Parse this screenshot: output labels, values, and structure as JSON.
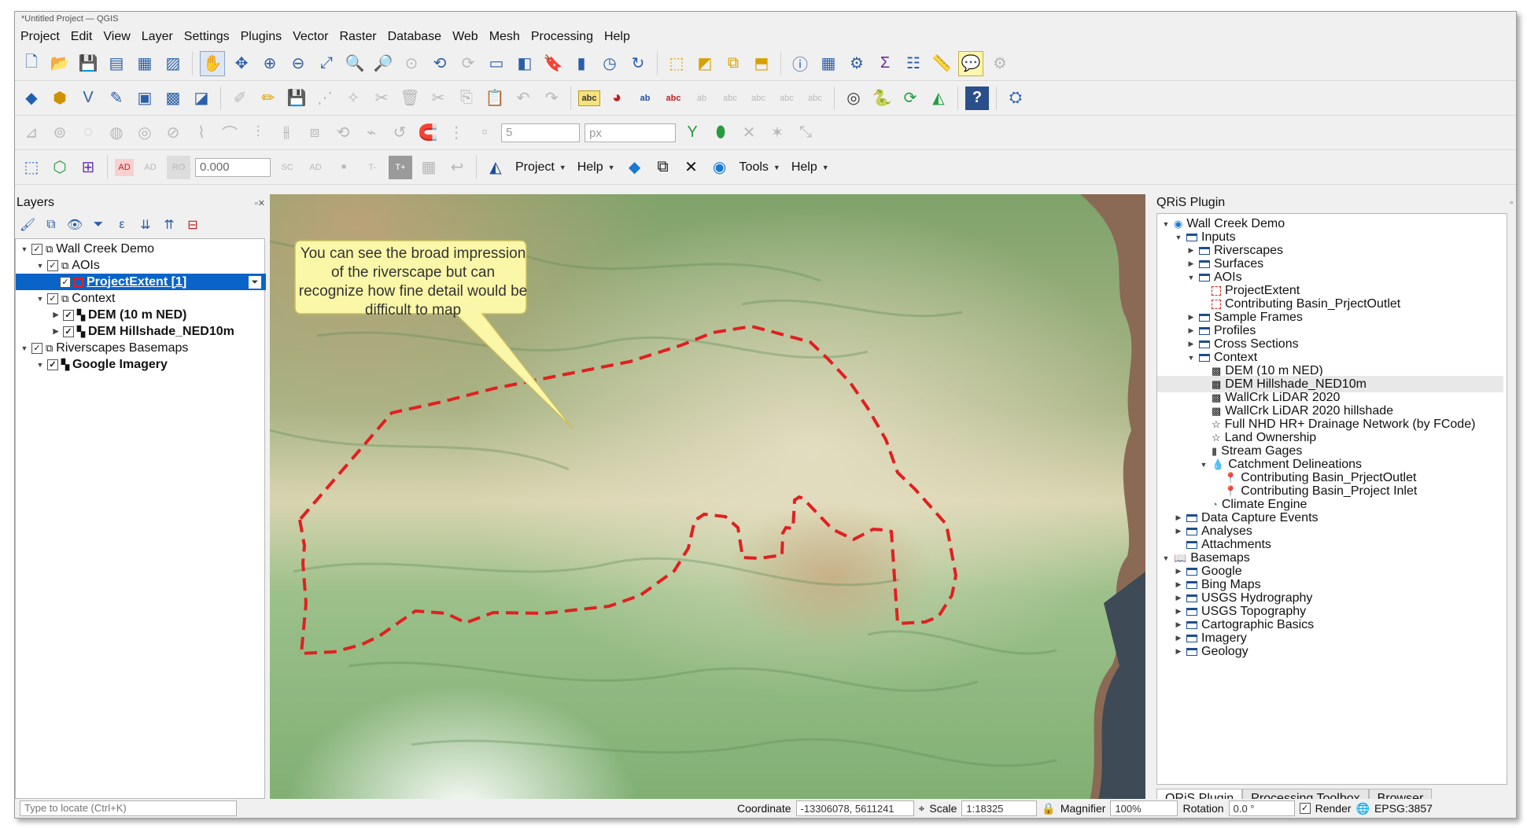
{
  "window": {
    "title": "*Untitled Project — QGIS"
  },
  "menu": [
    "Project",
    "Edit",
    "View",
    "Layer",
    "Settings",
    "Plugins",
    "Vector",
    "Raster",
    "Database",
    "Web",
    "Mesh",
    "Processing",
    "Help"
  ],
  "toolbar4": {
    "value_field": "0.000",
    "snap_tolerance": "5",
    "snap_unit": "px",
    "project_menu": "Project",
    "help_menu": "Help",
    "tools_menu": "Tools",
    "help_menu2": "Help"
  },
  "layers_panel": {
    "title": "Layers",
    "items": [
      {
        "label": "Wall Creek Demo"
      },
      {
        "label": "AOIs"
      },
      {
        "label": "ProjectExtent [1]"
      },
      {
        "label": "Context"
      },
      {
        "label": "DEM (10 m NED)"
      },
      {
        "label": "DEM Hillshade_NED10m"
      },
      {
        "label": "Riverscapes Basemaps"
      },
      {
        "label": "Google Imagery"
      }
    ]
  },
  "callout": {
    "text": "You can see the broad impression of the riverscape but can recognize how fine detail would be difficult to map"
  },
  "qris_panel": {
    "title": "QRiS Plugin",
    "items": [
      {
        "label": "Wall Creek Demo"
      },
      {
        "label": "Inputs"
      },
      {
        "label": "Riverscapes"
      },
      {
        "label": "Surfaces"
      },
      {
        "label": "AOIs"
      },
      {
        "label": "ProjectExtent"
      },
      {
        "label": "Contributing Basin_PrjectOutlet"
      },
      {
        "label": "Sample Frames"
      },
      {
        "label": "Profiles"
      },
      {
        "label": "Cross Sections"
      },
      {
        "label": "Context"
      },
      {
        "label": "DEM (10 m NED)"
      },
      {
        "label": "DEM Hillshade_NED10m"
      },
      {
        "label": "WallCrk LiDAR 2020"
      },
      {
        "label": "WallCrk LiDAR 2020 hillshade"
      },
      {
        "label": "Full NHD HR+ Drainage Network (by FCode)"
      },
      {
        "label": "Land Ownership"
      },
      {
        "label": "Stream Gages"
      },
      {
        "label": "Catchment Delineations"
      },
      {
        "label": "Contributing Basin_PrjectOutlet"
      },
      {
        "label": "Contributing Basin_Project Inlet"
      },
      {
        "label": "Climate Engine"
      },
      {
        "label": "Data Capture Events"
      },
      {
        "label": "Analyses"
      },
      {
        "label": "Attachments"
      },
      {
        "label": "Basemaps"
      },
      {
        "label": "Google"
      },
      {
        "label": "Bing Maps"
      },
      {
        "label": "USGS Hydrography"
      },
      {
        "label": "USGS Topography"
      },
      {
        "label": "Cartographic Basics"
      },
      {
        "label": "Imagery"
      },
      {
        "label": "Geology"
      }
    ],
    "tabs": [
      "QRiS Plugin",
      "Processing Toolbox",
      "Browser"
    ]
  },
  "statusbar": {
    "locator_placeholder": "Type to locate (Ctrl+K)",
    "coordinate_label": "Coordinate",
    "coordinate": "-13306078, 5611241",
    "scale_label": "Scale",
    "scale": "1:18325",
    "magnifier_label": "Magnifier",
    "magnifier": "100%",
    "rotation_label": "Rotation",
    "rotation": "0.0 °",
    "render_label": "Render",
    "crs": "EPSG:3857"
  },
  "colors": {
    "selection": "#0a64c8",
    "aoi_outline": "#e02020",
    "callout_fill": "#fbf7a8"
  }
}
